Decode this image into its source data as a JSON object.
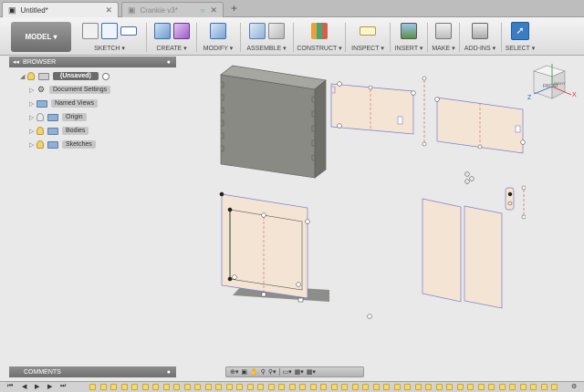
{
  "tabs": [
    {
      "label": "Untitled*",
      "active": true
    },
    {
      "label": "Crankie v3*",
      "active": false
    }
  ],
  "toolbar": {
    "model_label": "MODEL ▾",
    "groups": [
      "SKETCH ▾",
      "CREATE ▾",
      "MODIFY ▾",
      "ASSEMBLE ▾",
      "CONSTRUCT ▾",
      "INSPECT ▾",
      "INSERT ▾",
      "MAKE ▾",
      "ADD-INS ▾",
      "SELECT ▾"
    ]
  },
  "browser": {
    "title": "BROWSER",
    "root": "(Unsaved)",
    "items": [
      "Document Settings",
      "Named Views",
      "Origin",
      "Bodies",
      "Sketches"
    ]
  },
  "comments": {
    "title": "COMMENTS"
  },
  "viewcube": {
    "front": "FRONT",
    "right": "RIGHT",
    "x": "X",
    "z": "Z"
  },
  "colors": {
    "panel_fill": "#f3e4d3",
    "panel_stroke": "#7b7bd0",
    "box_fill": "#8a8a84",
    "accent_select": "#3a7dc0"
  }
}
